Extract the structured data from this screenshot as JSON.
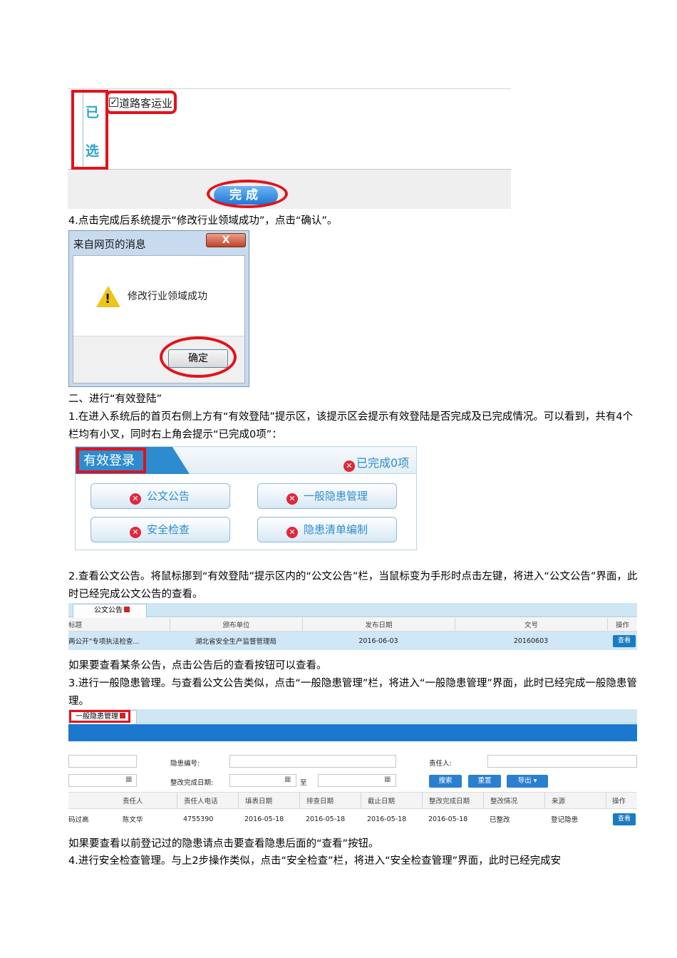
{
  "shot1": {
    "selected_chars": [
      "已",
      "选"
    ],
    "checkbox_mark": "✓",
    "checkbox_label": "道路客运业",
    "done_button": "完成"
  },
  "step4_text": "4.点击完成后系统提示“修改行业领域成功”，点击“确认”。",
  "dialog": {
    "title": "来自网页的消息",
    "close_label": "X",
    "message": "修改行业领域成功",
    "ok_button": "确定"
  },
  "section2_heading": "二、进行“有效登陆”",
  "section2_para1": "1.在进入系统后的首页右侧上方有“有效登陆”提示区，该提示区会提示有效登陆是否完成及已完成情况。可以看到，共有4个栏均有小叉，同时右上角会提示“已完成0项”：",
  "panel": {
    "title": "有效登录",
    "done_state": "已完成0项",
    "buttons": [
      "公文公告",
      "一般隐患管理",
      "安全检查",
      "隐患清单编制"
    ]
  },
  "section2_para2": "2.查看公文公告。将鼠标挪到“有效登陆”提示区内的“公文公告”栏，当鼠标变为手形时点击左键，将进入“公文公告”界面，此时已经完成公文公告的查看。",
  "table1": {
    "tab": "公文公告",
    "headers": [
      "标题",
      "颁布单位",
      "发布日期",
      "文号",
      "操作"
    ],
    "row": [
      "两公开”专项执法检查...",
      "湖北省安全生产监督管理局",
      "2016-06-03",
      "20160603"
    ],
    "action": "查看"
  },
  "para_view_notice": "如果要查看某条公告，点击公告后的查看按钮可以查看。",
  "para_step3": "3.进行一般隐患管理。与查看公文公告类似，点击“一般隐患管理”栏，将进入“一般隐患管理”界面，此时已经完成一般隐患管理。",
  "table2": {
    "tab": "一般隐患管理",
    "label_hazard_no": "隐患编号:",
    "label_responsible": "责任人:",
    "label_rect_date": "整改完成日期:",
    "label_to": "至",
    "buttons": [
      "搜索",
      "重置",
      "导出 ▾"
    ],
    "headers": [
      "责任人",
      "责任人电话",
      "填表日期",
      "排查日期",
      "截止日期",
      "整改完成日期",
      "整改情况",
      "来源",
      "操作"
    ],
    "row": [
      "码过高",
      "陈文华",
      "4755390",
      "2016-05-18",
      "2016-05-18",
      "2016-05-18",
      "2016-05-18",
      "已整改",
      "登记隐患"
    ],
    "action": "查看"
  },
  "para_view_hazard": "如果要查看以前登记过的隐患请点击要查看隐患后面的“查看”按钮。",
  "para_step4": "4.进行安全检查管理。与上2步操作类似，点击“安全检查”栏，将进入“安全检查管理”界面，此时已经完成安"
}
